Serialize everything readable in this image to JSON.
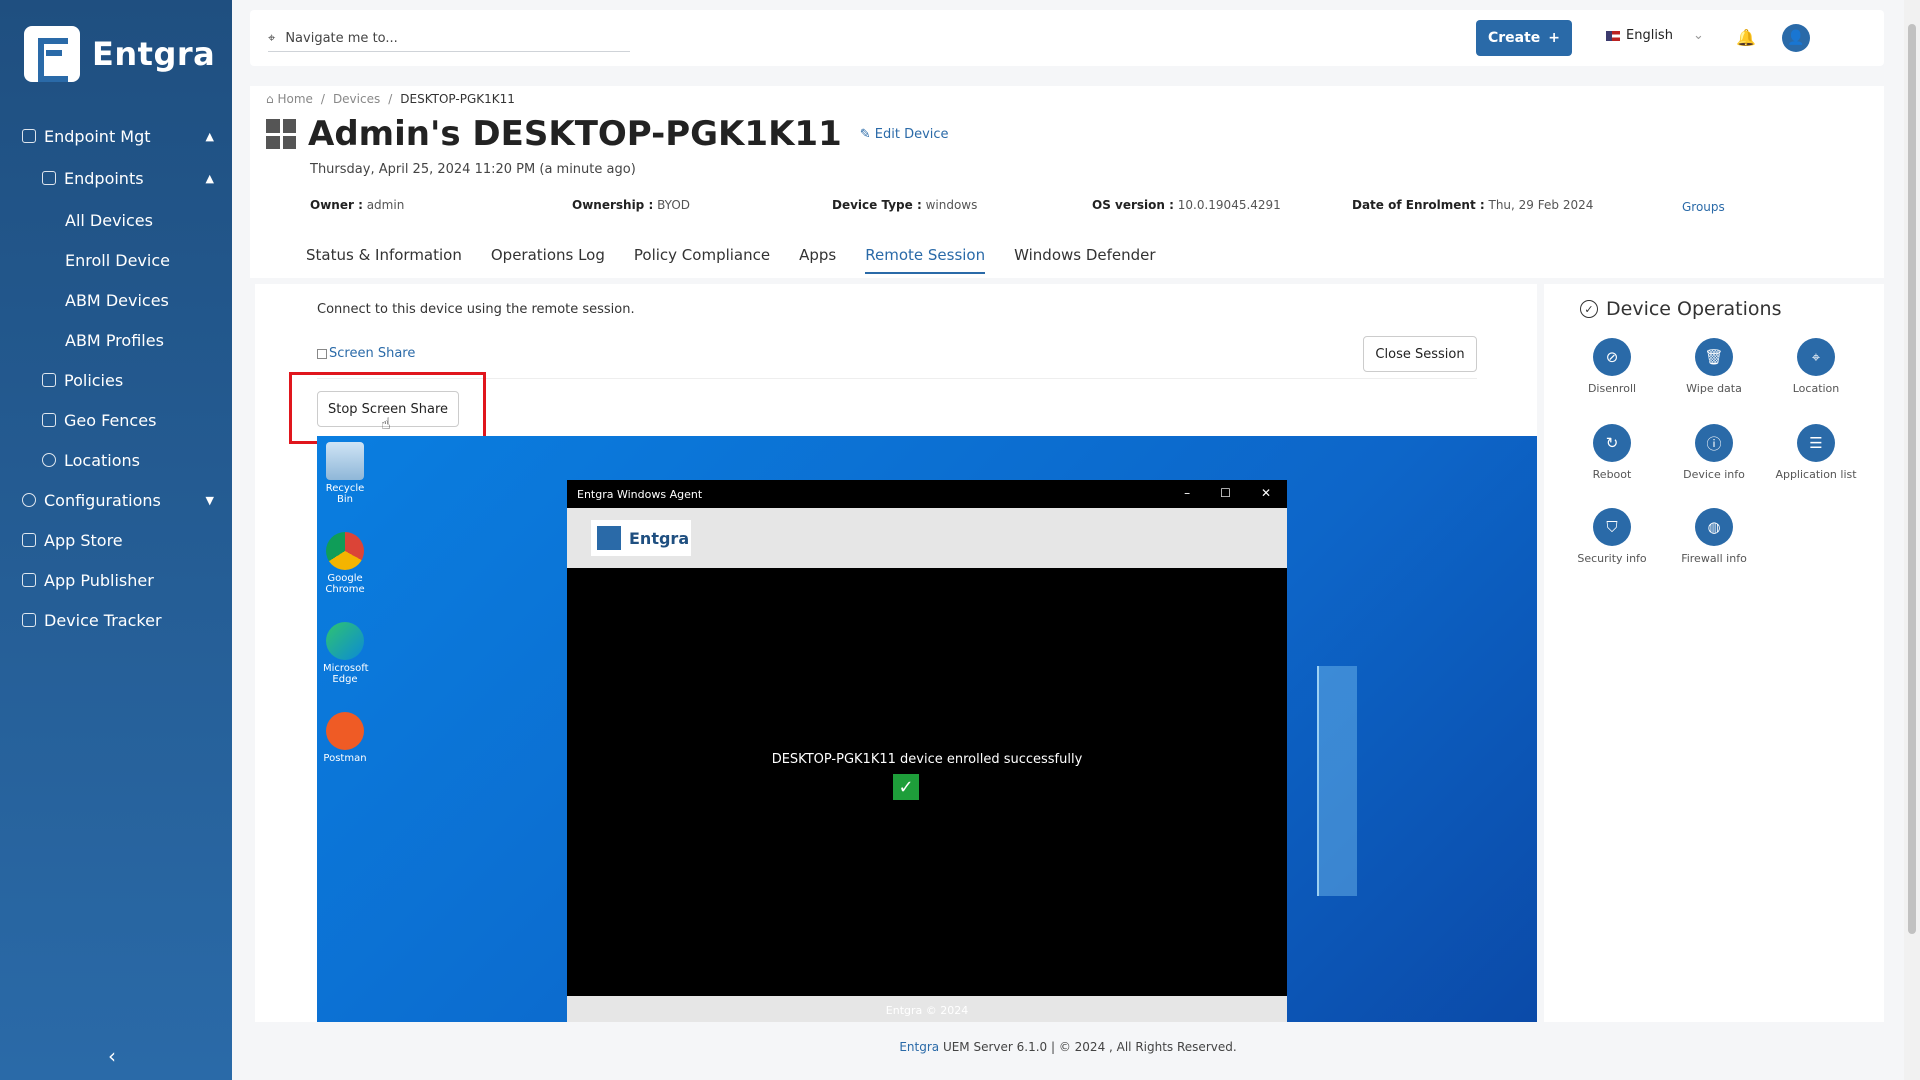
{
  "sidebar": {
    "brand": "Entgra",
    "items": [
      {
        "label": "Endpoint Mgt"
      },
      {
        "label": "Endpoints"
      },
      {
        "label": "All Devices"
      },
      {
        "label": "Enroll Device"
      },
      {
        "label": "ABM Devices"
      },
      {
        "label": "ABM Profiles"
      },
      {
        "label": "Policies"
      },
      {
        "label": "Geo Fences"
      },
      {
        "label": "Locations"
      },
      {
        "label": "Configurations"
      },
      {
        "label": "App Store"
      },
      {
        "label": "App Publisher"
      },
      {
        "label": "Device Tracker"
      }
    ],
    "collapse_glyph": "‹"
  },
  "topbar": {
    "navigate_placeholder": "Navigate me to...",
    "create_label": "Create",
    "create_glyph": "+",
    "language": "English"
  },
  "breadcrumb": {
    "home": "Home",
    "devices": "Devices",
    "current": "DESKTOP-PGK1K11",
    "sep": "/"
  },
  "device": {
    "title": "Admin's DESKTOP-PGK1K11",
    "edit_label": "Edit Device",
    "date_line": "Thursday, April 25, 2024 11:20 PM (a minute ago)",
    "owner_label": "Owner :",
    "owner": "admin",
    "ownership_label": "Ownership :",
    "ownership": "BYOD",
    "type_label": "Device Type :",
    "type": "windows",
    "os_label": "OS version :",
    "os": "10.0.19045.4291",
    "enrol_label": "Date of Enrolment :",
    "enrol": "Thu, 29 Feb 2024",
    "groups_label": "Groups"
  },
  "tabs": [
    {
      "label": "Status & Information"
    },
    {
      "label": "Operations Log"
    },
    {
      "label": "Policy Compliance"
    },
    {
      "label": "Apps"
    },
    {
      "label": "Remote Session",
      "active": true
    },
    {
      "label": "Windows Defender"
    }
  ],
  "session": {
    "connect_text": "Connect to this device using the remote session.",
    "screen_share_label": "Screen Share",
    "close_label": "Close Session",
    "stop_label": "Stop Screen Share"
  },
  "remote": {
    "icons": [
      {
        "label": "Recycle Bin"
      },
      {
        "label": "Google Chrome"
      },
      {
        "label": "Microsoft Edge"
      },
      {
        "label": "Postman"
      }
    ],
    "agent_title": "Entgra Windows Agent",
    "agent_brand": "Entgra",
    "agent_message": "DESKTOP-PGK1K11 device enrolled successfully",
    "agent_footer": "Entgra © 2024"
  },
  "operations": {
    "title": "Device Operations",
    "items": [
      {
        "label": "Disenroll",
        "icon": "disenroll-icon"
      },
      {
        "label": "Wipe data",
        "icon": "trash-icon"
      },
      {
        "label": "Location",
        "icon": "location-icon"
      },
      {
        "label": "Reboot",
        "icon": "reboot-icon"
      },
      {
        "label": "Device info",
        "icon": "info-icon"
      },
      {
        "label": "Application list",
        "icon": "list-icon"
      },
      {
        "label": "Security info",
        "icon": "shield-icon"
      },
      {
        "label": "Firewall info",
        "icon": "globe-icon"
      }
    ]
  },
  "footer": {
    "brand": "Entgra",
    "text": " UEM Server 6.1.0 | © 2024 , All Rights Reserved."
  },
  "colors": {
    "primary": "#2a6aa8",
    "highlight": "#e0161d",
    "success": "#1e9e3a"
  }
}
